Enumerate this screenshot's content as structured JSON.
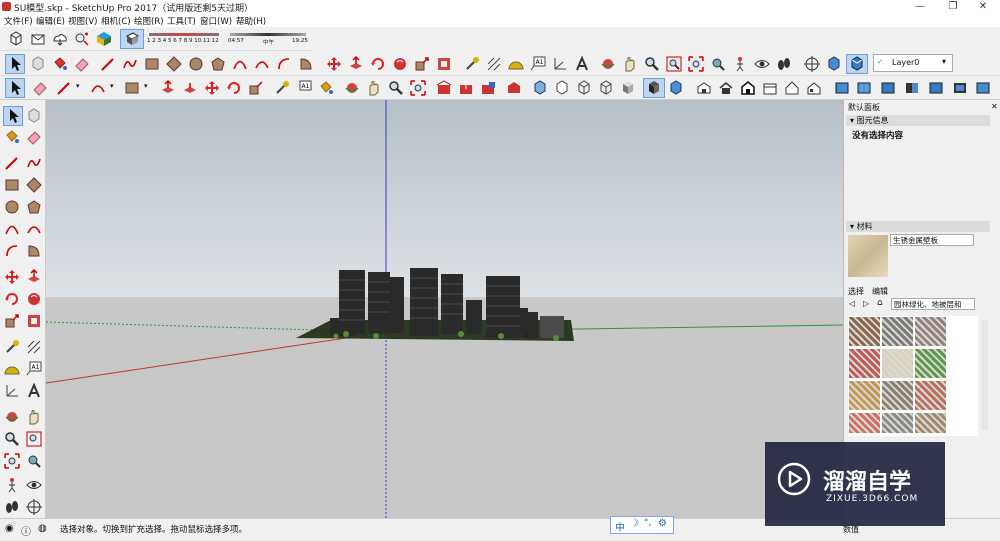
{
  "window": {
    "title": "SU模型.skp - SketchUp Pro 2017（试用版还剩5天过期）",
    "controls": [
      "minimize",
      "restore",
      "close"
    ]
  },
  "menubar": {
    "items": [
      "文件(F)",
      "编辑(E)",
      "视图(V)",
      "相机(C)",
      "绘图(R)",
      "工具(T)",
      "窗口(W)",
      "帮助(H)"
    ]
  },
  "shadow_bar": {
    "months": "1 2 3 4 5 6 7 8 9 10 11 12",
    "time_start": "04:57",
    "time_mid": "中午",
    "time_end": "19:25"
  },
  "layer_dropdown": {
    "value": "Layer0"
  },
  "panel": {
    "tray_title": "默认面板",
    "entity_info": {
      "header": "图元信息",
      "text": "没有选择内容"
    },
    "materials": {
      "header": "材料",
      "current_name": "生锈金属壁板",
      "tabs": [
        "选择",
        "编辑"
      ],
      "library": "园林绿化、地被层和",
      "swatch_colors": [
        "#8a6a4a",
        "#7d7b78",
        "#94837a",
        "#c05a52",
        "#d9d0b8",
        "#5f9a48",
        "#c49a58",
        "#8a8070",
        "#b8705a",
        "#d07060",
        "#8a8a84",
        "#a08a6a"
      ]
    }
  },
  "status": {
    "text": "选择对象。切换到扩充选择。拖动鼠标选择多项。",
    "measure_label": "数值"
  },
  "ime": {
    "mode": "中"
  },
  "watermark": {
    "brand": "溜溜自学",
    "url": "ZIXUE.3D66.COM"
  },
  "colors": {
    "sky_top": "#b7c0c8",
    "ground": "#c8c8c8",
    "axis_red": "#c0392b",
    "axis_green": "#2e9a3a",
    "axis_blue": "#3b3bd0"
  }
}
